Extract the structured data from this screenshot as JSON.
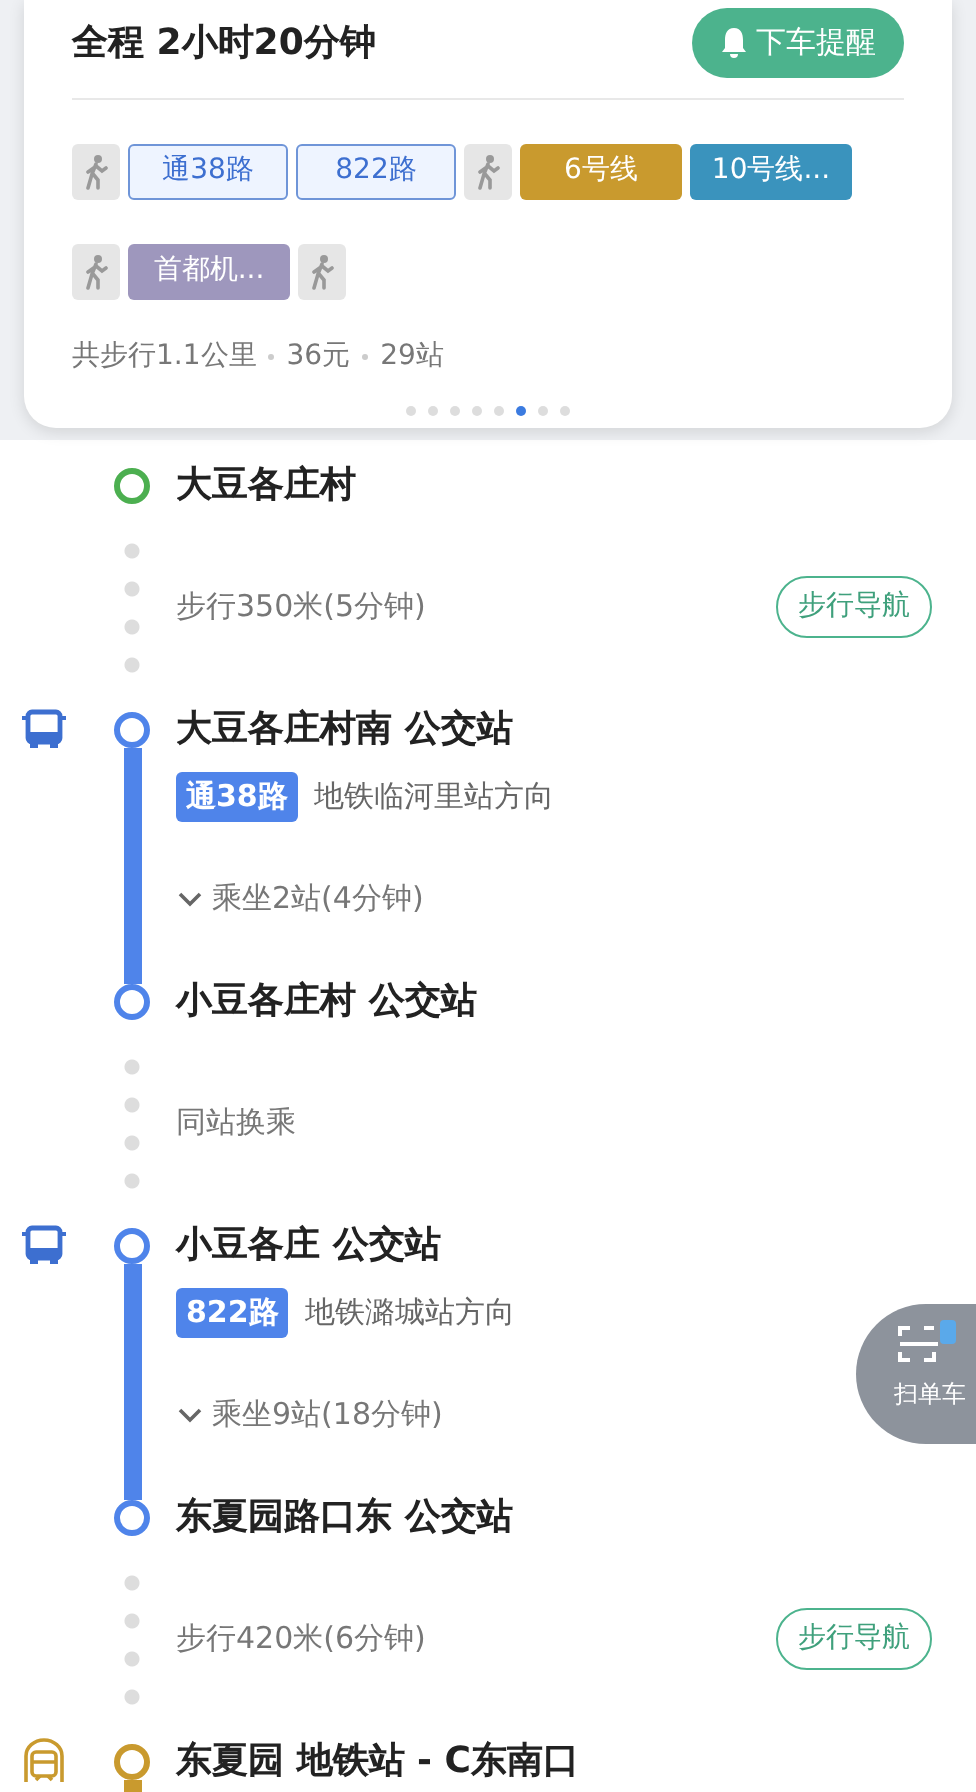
{
  "summary_card": {
    "title": "全程 2小时20分钟",
    "alert_button": "下车提醒",
    "segments": [
      {
        "kind": "walk"
      },
      {
        "kind": "bus",
        "label": "通38路"
      },
      {
        "kind": "bus",
        "label": "822路"
      },
      {
        "kind": "walk"
      },
      {
        "kind": "subway",
        "label": "6号线",
        "color": "#c99a2e"
      },
      {
        "kind": "subway",
        "label": "10号线...",
        "color": "#3a93bd"
      },
      {
        "kind": "walk"
      },
      {
        "kind": "subway",
        "label": "首都机...",
        "color": "#9e97bd"
      },
      {
        "kind": "walk"
      }
    ],
    "stats": [
      "共步行1.1公里",
      "36元",
      "29站"
    ],
    "pager": [
      {
        "selected": false
      },
      {
        "selected": false
      },
      {
        "selected": false
      },
      {
        "selected": false
      },
      {
        "selected": false
      },
      {
        "selected": true
      },
      {
        "selected": false
      },
      {
        "selected": false
      }
    ]
  },
  "steps": [
    {
      "kind": "start",
      "name": "大豆各庄村"
    },
    {
      "kind": "walk",
      "text": "步行350米(5分钟)",
      "button": "步行导航"
    },
    {
      "kind": "board",
      "name": "大豆各庄村南 公交站",
      "line": "通38路",
      "direction": "地铁临河里站方向"
    },
    {
      "kind": "ride",
      "text": "乘坐2站(4分钟)"
    },
    {
      "kind": "alight",
      "name": "小豆各庄村 公交站"
    },
    {
      "kind": "transfer",
      "text": "同站换乘"
    },
    {
      "kind": "board",
      "name": "小豆各庄 公交站",
      "line": "822路",
      "direction": "地铁潞城站方向"
    },
    {
      "kind": "ride",
      "text": "乘坐9站(18分钟)"
    },
    {
      "kind": "alight",
      "name": "东夏园路口东 公交站"
    },
    {
      "kind": "walk",
      "text": "步行420米(6分钟)",
      "button": "步行导航"
    },
    {
      "kind": "metro",
      "name": "东夏园 地铁站 - C东南口"
    }
  ],
  "scan_button": {
    "label": "扫单车"
  }
}
